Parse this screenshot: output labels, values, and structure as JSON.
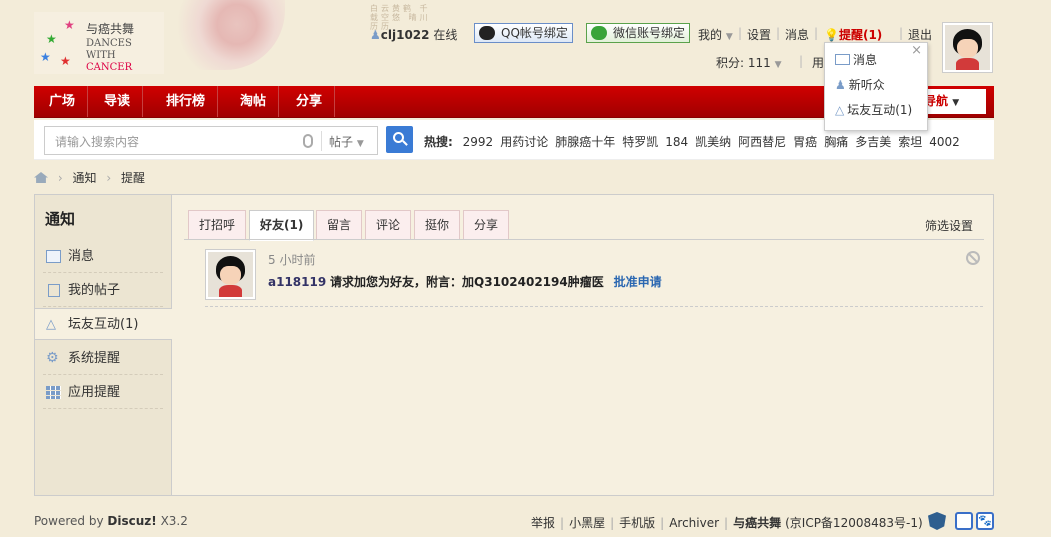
{
  "logo": {
    "cn": "与癌共舞",
    "en1": "DANCES WITH",
    "en2": "CANCER"
  },
  "calligraphy": "白云黄鹤 千载空悠 晴川历历",
  "userbar": {
    "username": "clj1022",
    "status": "在线",
    "qq_bind": "QQ帐号绑定",
    "wechat_bind": "微信账号绑定",
    "my": "我的",
    "settings": "设置",
    "messages": "消息",
    "reminders": "提醒(1)",
    "logout": "退出",
    "points": "积分: 111",
    "use": "用"
  },
  "popup": {
    "items": [
      "消息",
      "新听众",
      "坛友互动(1)"
    ],
    "close": "×"
  },
  "nav": {
    "items": [
      "广场",
      "导读",
      "排行榜",
      "淘帖",
      "分享"
    ],
    "right_label": "导航"
  },
  "search": {
    "placeholder": "请输入搜索内容",
    "type": "帖子",
    "hot_label": "热搜:",
    "hot": [
      "2992",
      "用药讨论",
      "肺腺癌十年",
      "特罗凯",
      "184",
      "凯美纳",
      "阿西替尼",
      "胃癌",
      "胸痛",
      "多吉美",
      "索坦",
      "4002"
    ]
  },
  "breadcrumb": [
    "通知",
    "提醒"
  ],
  "sidebar": {
    "title": "通知",
    "items": [
      {
        "label": "消息",
        "icon": "envelope-icon"
      },
      {
        "label": "我的帖子",
        "icon": "document-icon"
      },
      {
        "label": "坛友互动(1)",
        "icon": "recycle-icon"
      },
      {
        "label": "系统提醒",
        "icon": "gear-icon"
      },
      {
        "label": "应用提醒",
        "icon": "grid-icon"
      }
    ]
  },
  "tabs": [
    "打招呼",
    "好友(1)",
    "留言",
    "评论",
    "挺你",
    "分享"
  ],
  "filter_settings": "筛选设置",
  "notice": {
    "time": "5 小时前",
    "user": "a118119",
    "text": "请求加您为好友，附言：加Q3102402194肿瘤医",
    "approve": "批准申请"
  },
  "footer": {
    "powered_prefix": "Powered by",
    "powered_brand": "Discuz!",
    "powered_version": "X3.2",
    "links": [
      "举报",
      "小黑屋",
      "手机版",
      "Archiver",
      "与癌共舞",
      "京ICP备12008483号-1"
    ]
  }
}
